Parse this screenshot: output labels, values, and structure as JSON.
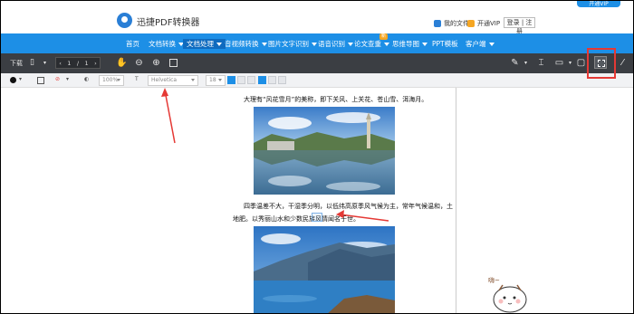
{
  "brand": {
    "name": "迅捷PDF转换器",
    "corner_label": "开通VIP"
  },
  "top_links": {
    "my_files": "我的文件",
    "vip": "开通VIP",
    "login": "登录 | 注册"
  },
  "nav": {
    "items": [
      {
        "label": "首页",
        "dropdown": false
      },
      {
        "label": "文档转换",
        "dropdown": true
      },
      {
        "label": "文档处理",
        "dropdown": true,
        "active": true
      },
      {
        "label": "音视频转换",
        "dropdown": true
      },
      {
        "label": "图片文字识别",
        "dropdown": true
      },
      {
        "label": "语音识别",
        "dropdown": true
      },
      {
        "label": "论文查重",
        "dropdown": true
      },
      {
        "label": "思维导图",
        "dropdown": true
      },
      {
        "label": "PPT模板",
        "dropdown": false
      },
      {
        "label": "客户端",
        "dropdown": true
      }
    ],
    "new_badge": "新"
  },
  "toolbar": {
    "download": "下载",
    "page_current": "1",
    "page_sep": "/",
    "page_total": "1"
  },
  "format": {
    "zoom": "100%",
    "font": "Helvetica",
    "size": "18"
  },
  "doc": {
    "line1": "大理有“风花雪月”的美称，即下关风、上关花、苍山雪、洱海月。",
    "line2": "四季温差不大，干湿季分明，以低纬高原季风气候为主，常年气候温和，土",
    "line3": "地肥。以秀丽山水和少数民族风情闻名于世。"
  },
  "mascot_text": "嗨~",
  "colors": {
    "nav_blue": "#1d8fe6",
    "toolbar_dark": "#3b3e43",
    "annotation_red": "#e53935"
  }
}
